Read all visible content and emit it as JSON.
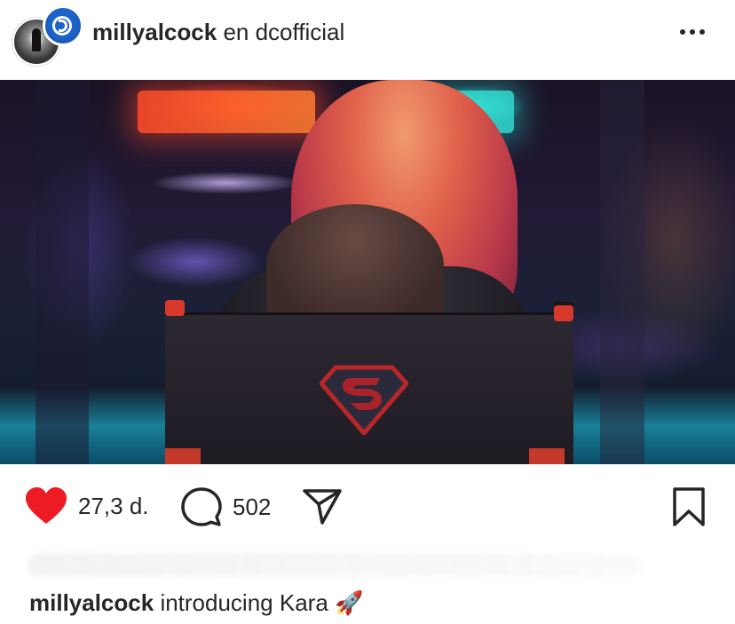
{
  "post": {
    "username": "millyalcock",
    "separator": "en",
    "collab_account": "dcofficial",
    "menu_icon": "more-horizontal-icon",
    "brand_badge_icon": "dc-logo-icon"
  },
  "actions": {
    "likes": "27,3 d.",
    "comments": "502",
    "like_icon": "heart-filled-icon",
    "comment_icon": "comment-icon",
    "share_icon": "paper-plane-icon",
    "save_icon": "bookmark-icon",
    "like_color": "#ed1c24"
  },
  "caption": {
    "username": "millyalcock",
    "text": "introducing Kara",
    "emoji": "🚀"
  }
}
